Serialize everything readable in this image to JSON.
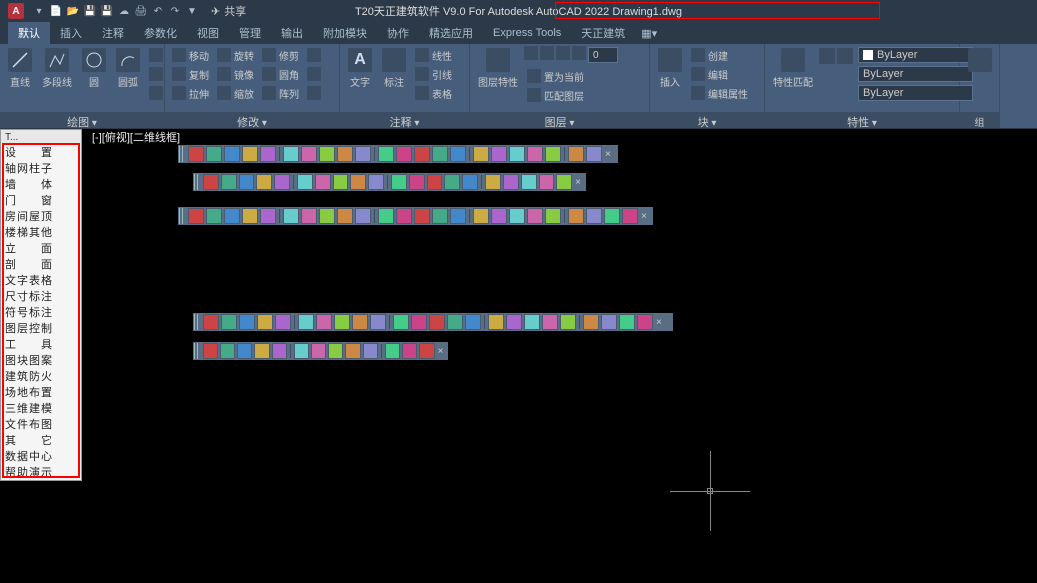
{
  "title_bar": {
    "app_letter": "A",
    "share_label": "共享",
    "title": "T20天正建筑软件 V9.0 For Autodesk AutoCAD 2022   Drawing1.dwg"
  },
  "ribbon_tabs": [
    "默认",
    "插入",
    "注释",
    "参数化",
    "视图",
    "管理",
    "输出",
    "附加模块",
    "协作",
    "精选应用",
    "Express Tools",
    "天正建筑"
  ],
  "ribbon": {
    "draw": {
      "title": "绘图",
      "b1": "直线",
      "b2": "多段线",
      "b3": "圆",
      "b4": "圆弧"
    },
    "modify": {
      "title": "修改",
      "m1": "移动",
      "m2": "复制",
      "m3": "拉伸",
      "m4": "旋转",
      "m5": "镜像",
      "m6": "缩放",
      "m7": "修剪",
      "m8": "圆角",
      "m9": "阵列"
    },
    "annot": {
      "title": "注释",
      "a1": "文字",
      "a2": "标注",
      "a3": "引线",
      "a4": "表格"
    },
    "layer": {
      "title": "图层",
      "l1": "图层特性",
      "l2": "置为当前",
      "l3": "匹配图层"
    },
    "block": {
      "title": "块",
      "b1": "插入",
      "b2": "创建",
      "b3": "编辑",
      "b4": "编辑属性"
    },
    "prop": {
      "title": "特性",
      "p1": "特性匹配",
      "combo1": "ByLayer",
      "combo2": "ByLayer",
      "combo3": "ByLayer"
    },
    "group": {
      "title": "组"
    }
  },
  "sidebar": {
    "header": "T...",
    "items": [
      "设　　置",
      "轴网柱子",
      "墙　　体",
      "门　　窗",
      "房间屋顶",
      "楼梯其他",
      "立　　面",
      "剖　　面",
      "文字表格",
      "尺寸标注",
      "符号标注",
      "图层控制",
      "工　　具",
      "图块图案",
      "建筑防火",
      "场地布置",
      "三维建模",
      "文件布图",
      "其　　它",
      "数据中心",
      "帮助演示"
    ]
  },
  "viewport_label": "[-][俯视][二维线框]",
  "layer_panel": {
    "linew": "线性",
    "match": "引线"
  }
}
